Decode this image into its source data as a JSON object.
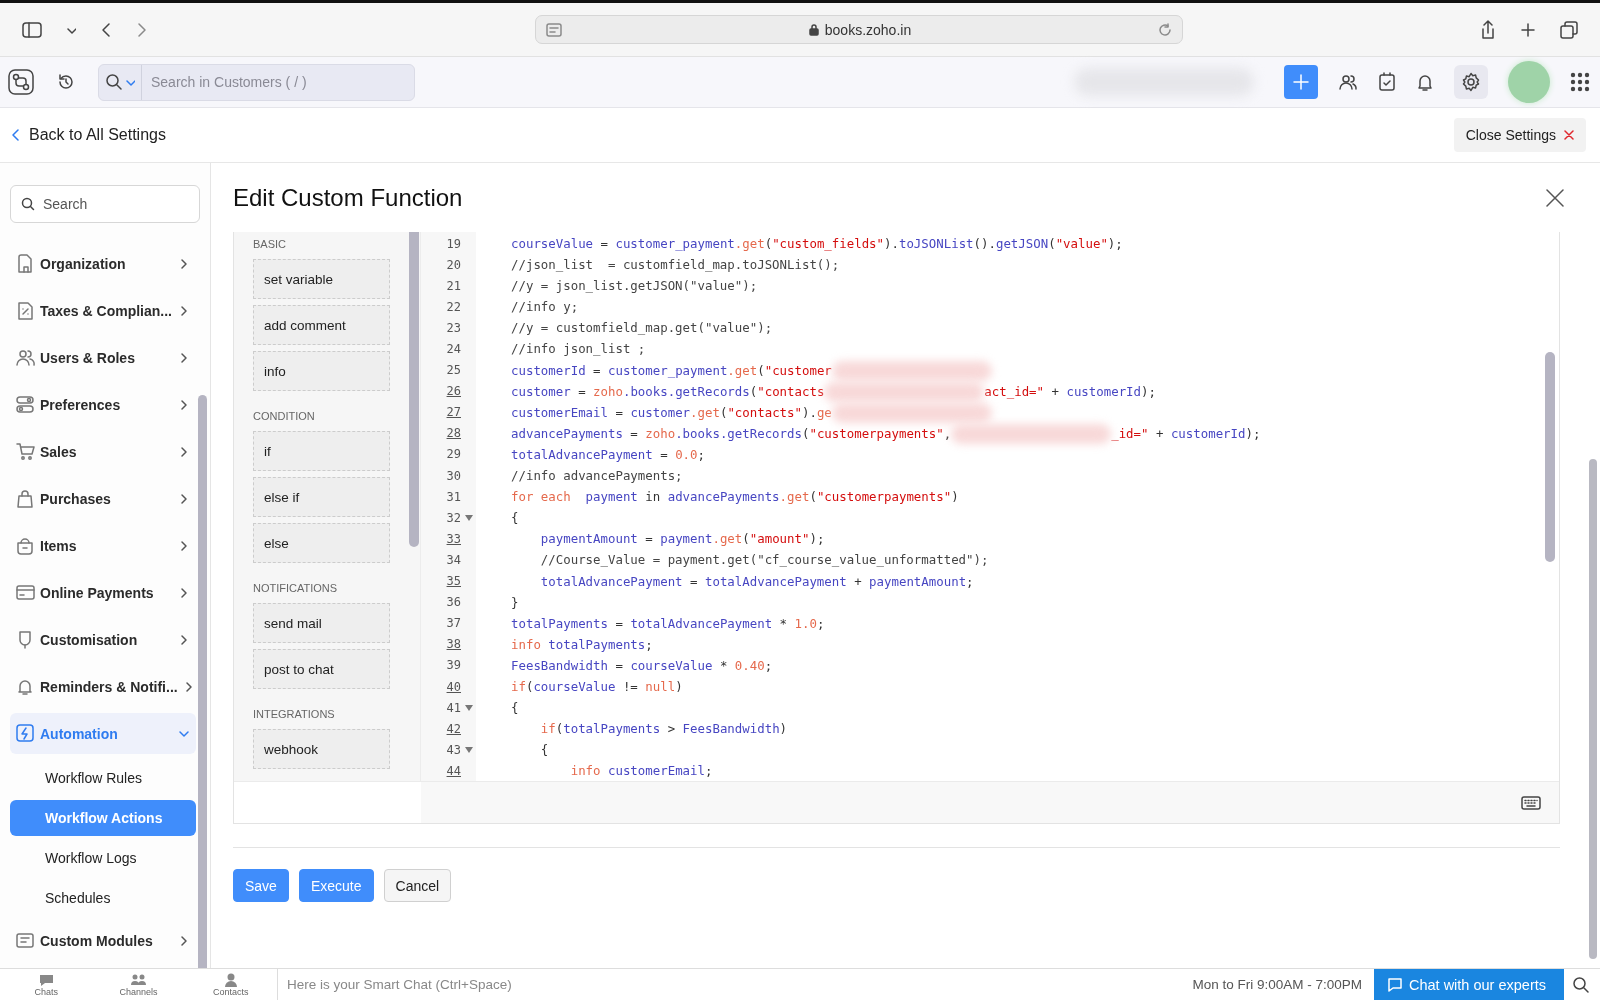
{
  "browser": {
    "url": "books.zoho.in"
  },
  "header": {
    "search_placeholder": "Search in Customers ( / )"
  },
  "settings_bar": {
    "back_link": "Back to All Settings",
    "close_button": "Close Settings"
  },
  "sidebar": {
    "search_placeholder": "Search",
    "items": [
      {
        "label": "Organization",
        "expanded": false,
        "selected": false
      },
      {
        "label": "Taxes & Complian...",
        "expanded": false,
        "selected": false
      },
      {
        "label": "Users & Roles",
        "expanded": false,
        "selected": false
      },
      {
        "label": "Preferences",
        "expanded": false,
        "selected": false
      },
      {
        "label": "Sales",
        "expanded": false,
        "selected": false
      },
      {
        "label": "Purchases",
        "expanded": false,
        "selected": false
      },
      {
        "label": "Items",
        "expanded": false,
        "selected": false
      },
      {
        "label": "Online Payments",
        "expanded": false,
        "selected": false
      },
      {
        "label": "Customisation",
        "expanded": false,
        "selected": false
      },
      {
        "label": "Reminders & Notifi...",
        "expanded": false,
        "selected": false
      },
      {
        "label": "Automation",
        "expanded": true,
        "selected": true,
        "children": [
          {
            "label": "Workflow Rules",
            "selected": false
          },
          {
            "label": "Workflow Actions",
            "selected": true
          },
          {
            "label": "Workflow Logs",
            "selected": false
          },
          {
            "label": "Schedules",
            "selected": false
          }
        ]
      },
      {
        "label": "Custom Modules",
        "expanded": false,
        "selected": false
      }
    ]
  },
  "dialog": {
    "title": "Edit Custom Function",
    "palette": [
      {
        "heading": "BASIC",
        "items": [
          "set variable",
          "add comment",
          "info"
        ]
      },
      {
        "heading": "CONDITION",
        "items": [
          "if",
          "else if",
          "else"
        ]
      },
      {
        "heading": "NOTIFICATIONS",
        "items": [
          "send mail",
          "post to chat"
        ]
      },
      {
        "heading": "INTEGRATIONS",
        "items": [
          "webhook"
        ]
      }
    ],
    "code_lines": [
      {
        "number": "19",
        "underlined": false,
        "fold": false,
        "tokens": [
          {
            "kind": "var",
            "text": "courseValue"
          },
          {
            "kind": "plain",
            "text": " = "
          },
          {
            "kind": "var",
            "text": "customer_payment"
          },
          {
            "kind": "key",
            "text": ".get"
          },
          {
            "kind": "plain",
            "text": "("
          },
          {
            "kind": "str",
            "text": "\"custom_fields\""
          },
          {
            "kind": "plain",
            "text": ")."
          },
          {
            "kind": "var",
            "text": "toJSONList"
          },
          {
            "kind": "plain",
            "text": "()."
          },
          {
            "kind": "var",
            "text": "getJSON"
          },
          {
            "kind": "plain",
            "text": "("
          },
          {
            "kind": "str",
            "text": "\"value\""
          },
          {
            "kind": "plain",
            "text": ");"
          }
        ]
      },
      {
        "number": "20",
        "underlined": false,
        "fold": false,
        "tokens": [
          {
            "kind": "comment",
            "text": "//json_list  = customfield_map.toJSONList();"
          }
        ]
      },
      {
        "number": "21",
        "underlined": false,
        "fold": false,
        "tokens": [
          {
            "kind": "comment",
            "text": "//y = json_list.getJSON(\"value\");"
          }
        ]
      },
      {
        "number": "22",
        "underlined": false,
        "fold": false,
        "tokens": [
          {
            "kind": "comment",
            "text": "//info y;"
          }
        ]
      },
      {
        "number": "23",
        "underlined": false,
        "fold": false,
        "tokens": [
          {
            "kind": "comment",
            "text": "//y = customfield_map.get(\"value\");"
          }
        ]
      },
      {
        "number": "24",
        "underlined": false,
        "fold": false,
        "tokens": [
          {
            "kind": "comment",
            "text": "//info json_list ;"
          }
        ]
      },
      {
        "number": "25",
        "underlined": false,
        "fold": false,
        "tokens": [
          {
            "kind": "var",
            "text": "customerId"
          },
          {
            "kind": "plain",
            "text": " = "
          },
          {
            "kind": "var",
            "text": "customer_payment"
          },
          {
            "kind": "key",
            "text": ".get"
          },
          {
            "kind": "plain",
            "text": "("
          },
          {
            "kind": "str",
            "text": "\"customer"
          },
          {
            "kind": "redacted"
          }
        ]
      },
      {
        "number": "26",
        "underlined": true,
        "fold": false,
        "tokens": [
          {
            "kind": "var",
            "text": "customer"
          },
          {
            "kind": "plain",
            "text": " = "
          },
          {
            "kind": "key",
            "text": "zoho"
          },
          {
            "kind": "var",
            "text": ".books.getRecords"
          },
          {
            "kind": "plain",
            "text": "("
          },
          {
            "kind": "str",
            "text": "\"contacts"
          },
          {
            "kind": "redacted"
          },
          {
            "kind": "str",
            "text": "act_id=\""
          },
          {
            "kind": "plain",
            "text": " + "
          },
          {
            "kind": "var",
            "text": "customerId"
          },
          {
            "kind": "plain",
            "text": ");"
          }
        ]
      },
      {
        "number": "27",
        "underlined": true,
        "fold": false,
        "tokens": [
          {
            "kind": "var",
            "text": "customerEmail"
          },
          {
            "kind": "plain",
            "text": " = "
          },
          {
            "kind": "var",
            "text": "customer"
          },
          {
            "kind": "key",
            "text": ".get"
          },
          {
            "kind": "plain",
            "text": "("
          },
          {
            "kind": "str",
            "text": "\"contacts\""
          },
          {
            "kind": "plain",
            "text": ")."
          },
          {
            "kind": "key",
            "text": "ge"
          },
          {
            "kind": "redacted"
          }
        ]
      },
      {
        "number": "28",
        "underlined": true,
        "fold": false,
        "tokens": [
          {
            "kind": "var",
            "text": "advancePayments"
          },
          {
            "kind": "plain",
            "text": " = "
          },
          {
            "kind": "key",
            "text": "zoho"
          },
          {
            "kind": "var",
            "text": ".books.getRecords"
          },
          {
            "kind": "plain",
            "text": "("
          },
          {
            "kind": "str",
            "text": "\"customerpayments\""
          },
          {
            "kind": "plain",
            "text": ","
          },
          {
            "kind": "redacted"
          },
          {
            "kind": "str",
            "text": "_id=\""
          },
          {
            "kind": "plain",
            "text": " + "
          },
          {
            "kind": "var",
            "text": "customerId"
          },
          {
            "kind": "plain",
            "text": ");"
          }
        ]
      },
      {
        "number": "29",
        "underlined": false,
        "fold": false,
        "tokens": [
          {
            "kind": "var",
            "text": "totalAdvancePayment"
          },
          {
            "kind": "plain",
            "text": " = "
          },
          {
            "kind": "num",
            "text": "0.0"
          },
          {
            "kind": "plain",
            "text": ";"
          }
        ]
      },
      {
        "number": "30",
        "underlined": false,
        "fold": false,
        "tokens": [
          {
            "kind": "comment",
            "text": "//info advancePayments;"
          }
        ]
      },
      {
        "number": "31",
        "underlined": false,
        "fold": false,
        "tokens": [
          {
            "kind": "key",
            "text": "for each"
          },
          {
            "kind": "var",
            "text": "  payment"
          },
          {
            "kind": "plain",
            "text": " in "
          },
          {
            "kind": "var",
            "text": "advancePayments"
          },
          {
            "kind": "key",
            "text": ".get"
          },
          {
            "kind": "plain",
            "text": "("
          },
          {
            "kind": "str",
            "text": "\"customerpayments\""
          },
          {
            "kind": "plain",
            "text": ")"
          }
        ]
      },
      {
        "number": "32",
        "underlined": false,
        "fold": true,
        "tokens": [
          {
            "kind": "plain",
            "text": "{"
          }
        ]
      },
      {
        "number": "33",
        "underlined": true,
        "fold": false,
        "tokens": [
          {
            "kind": "var",
            "text": "    paymentAmount"
          },
          {
            "kind": "plain",
            "text": " = "
          },
          {
            "kind": "var",
            "text": "payment"
          },
          {
            "kind": "key",
            "text": ".get"
          },
          {
            "kind": "plain",
            "text": "("
          },
          {
            "kind": "str",
            "text": "\"amount\""
          },
          {
            "kind": "plain",
            "text": ");"
          }
        ]
      },
      {
        "number": "34",
        "underlined": false,
        "fold": false,
        "tokens": [
          {
            "kind": "comment",
            "text": "    //Course_Value = payment.get(\"cf_course_value_unformatted\");"
          }
        ]
      },
      {
        "number": "35",
        "underlined": true,
        "fold": false,
        "tokens": [
          {
            "kind": "var",
            "text": "    totalAdvancePayment"
          },
          {
            "kind": "plain",
            "text": " = "
          },
          {
            "kind": "var",
            "text": "totalAdvancePayment"
          },
          {
            "kind": "plain",
            "text": " + "
          },
          {
            "kind": "var",
            "text": "paymentAmount"
          },
          {
            "kind": "plain",
            "text": ";"
          }
        ]
      },
      {
        "number": "36",
        "underlined": false,
        "fold": false,
        "tokens": [
          {
            "kind": "plain",
            "text": "}"
          }
        ]
      },
      {
        "number": "37",
        "underlined": false,
        "fold": false,
        "tokens": [
          {
            "kind": "var",
            "text": "totalPayments"
          },
          {
            "kind": "plain",
            "text": " = "
          },
          {
            "kind": "var",
            "text": "totalAdvancePayment"
          },
          {
            "kind": "plain",
            "text": " * "
          },
          {
            "kind": "num",
            "text": "1.0"
          },
          {
            "kind": "plain",
            "text": ";"
          }
        ]
      },
      {
        "number": "38",
        "underlined": true,
        "fold": false,
        "tokens": [
          {
            "kind": "key",
            "text": "info"
          },
          {
            "kind": "var",
            "text": " totalPayments"
          },
          {
            "kind": "plain",
            "text": ";"
          }
        ]
      },
      {
        "number": "39",
        "underlined": false,
        "fold": false,
        "tokens": [
          {
            "kind": "var",
            "text": "FeesBandwidth"
          },
          {
            "kind": "plain",
            "text": " = "
          },
          {
            "kind": "var",
            "text": "courseValue"
          },
          {
            "kind": "plain",
            "text": " * "
          },
          {
            "kind": "num",
            "text": "0.40"
          },
          {
            "kind": "plain",
            "text": ";"
          }
        ]
      },
      {
        "number": "40",
        "underlined": true,
        "fold": false,
        "tokens": [
          {
            "kind": "key",
            "text": "if"
          },
          {
            "kind": "plain",
            "text": "("
          },
          {
            "kind": "var",
            "text": "courseValue"
          },
          {
            "kind": "plain",
            "text": " != "
          },
          {
            "kind": "key",
            "text": "null"
          },
          {
            "kind": "plain",
            "text": ")"
          }
        ]
      },
      {
        "number": "41",
        "underlined": false,
        "fold": true,
        "tokens": [
          {
            "kind": "plain",
            "text": "{"
          }
        ]
      },
      {
        "number": "42",
        "underlined": true,
        "fold": false,
        "tokens": [
          {
            "kind": "key",
            "text": "    if"
          },
          {
            "kind": "plain",
            "text": "("
          },
          {
            "kind": "var",
            "text": "totalPayments"
          },
          {
            "kind": "plain",
            "text": " > "
          },
          {
            "kind": "var",
            "text": "FeesBandwidth"
          },
          {
            "kind": "plain",
            "text": ")"
          }
        ]
      },
      {
        "number": "43",
        "underlined": false,
        "fold": true,
        "tokens": [
          {
            "kind": "plain",
            "text": "    {"
          }
        ]
      },
      {
        "number": "44",
        "underlined": true,
        "fold": false,
        "tokens": [
          {
            "kind": "key",
            "text": "        info"
          },
          {
            "kind": "var",
            "text": " customerEmail"
          },
          {
            "kind": "plain",
            "text": ";"
          }
        ]
      }
    ],
    "buttons": [
      {
        "label": "Save",
        "kind": "primary"
      },
      {
        "label": "Execute",
        "kind": "primary"
      },
      {
        "label": "Cancel",
        "kind": "secondary"
      }
    ]
  },
  "bottom_bar": {
    "tabs": [
      "Chats",
      "Channels",
      "Contacts"
    ],
    "chat_placeholder": "Here is your Smart Chat (Ctrl+Space)",
    "hours": "Mon to Fri 9:00AM - 7:00PM",
    "chat_button": "Chat with our experts"
  }
}
